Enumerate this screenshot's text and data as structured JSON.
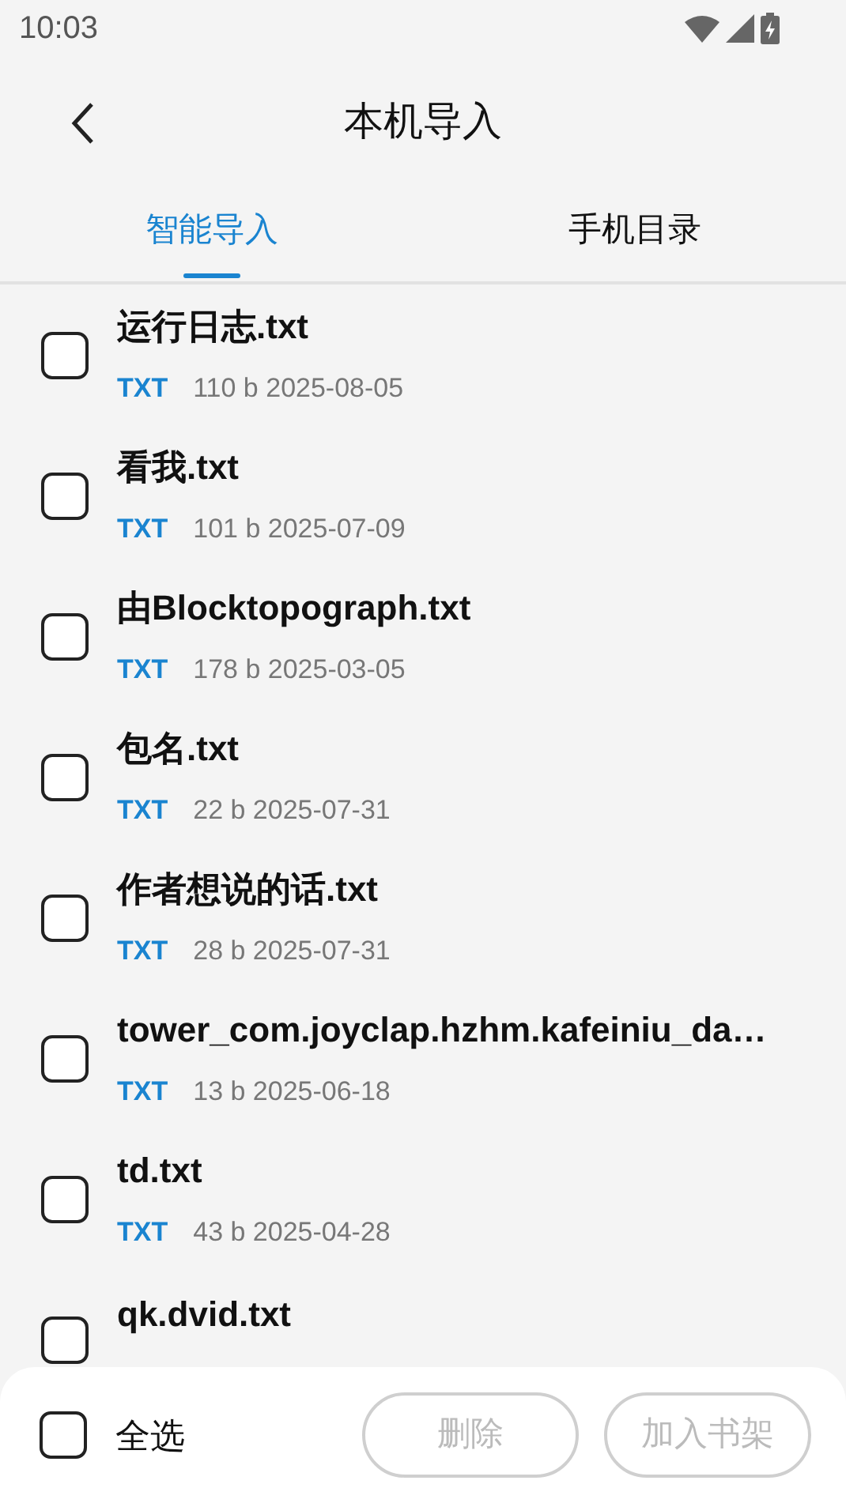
{
  "status_bar": {
    "time": "10:03"
  },
  "header": {
    "title": "本机导入"
  },
  "tabs": [
    {
      "label": "智能导入",
      "selected": true
    },
    {
      "label": "手机目录",
      "selected": false
    }
  ],
  "files": [
    {
      "name": "运行日志.txt",
      "type": "TXT",
      "size": "110 b",
      "date": "2025-08-05",
      "checked": false
    },
    {
      "name": "看我.txt",
      "type": "TXT",
      "size": "101 b",
      "date": "2025-07-09",
      "checked": false
    },
    {
      "name": "由Blocktopograph.txt",
      "type": "TXT",
      "size": "178 b",
      "date": "2025-03-05",
      "checked": false
    },
    {
      "name": "包名.txt",
      "type": "TXT",
      "size": "22 b",
      "date": "2025-07-31",
      "checked": false
    },
    {
      "name": "作者想说的话.txt",
      "type": "TXT",
      "size": "28 b",
      "date": "2025-07-31",
      "checked": false
    },
    {
      "name": "tower_com.joyclap.hzhm.kafeiniu_da…",
      "type": "TXT",
      "size": "13 b",
      "date": "2025-06-18",
      "checked": false
    },
    {
      "name": "td.txt",
      "type": "TXT",
      "size": "43 b",
      "date": "2025-04-28",
      "checked": false
    },
    {
      "name": "qk.dvid.txt",
      "checked": false
    }
  ],
  "bottom_bar": {
    "select_all": {
      "label": "全选",
      "checked": false
    },
    "buttons": [
      {
        "label": "删除",
        "disabled": true
      },
      {
        "label": "加入书架",
        "disabled": true
      }
    ]
  }
}
